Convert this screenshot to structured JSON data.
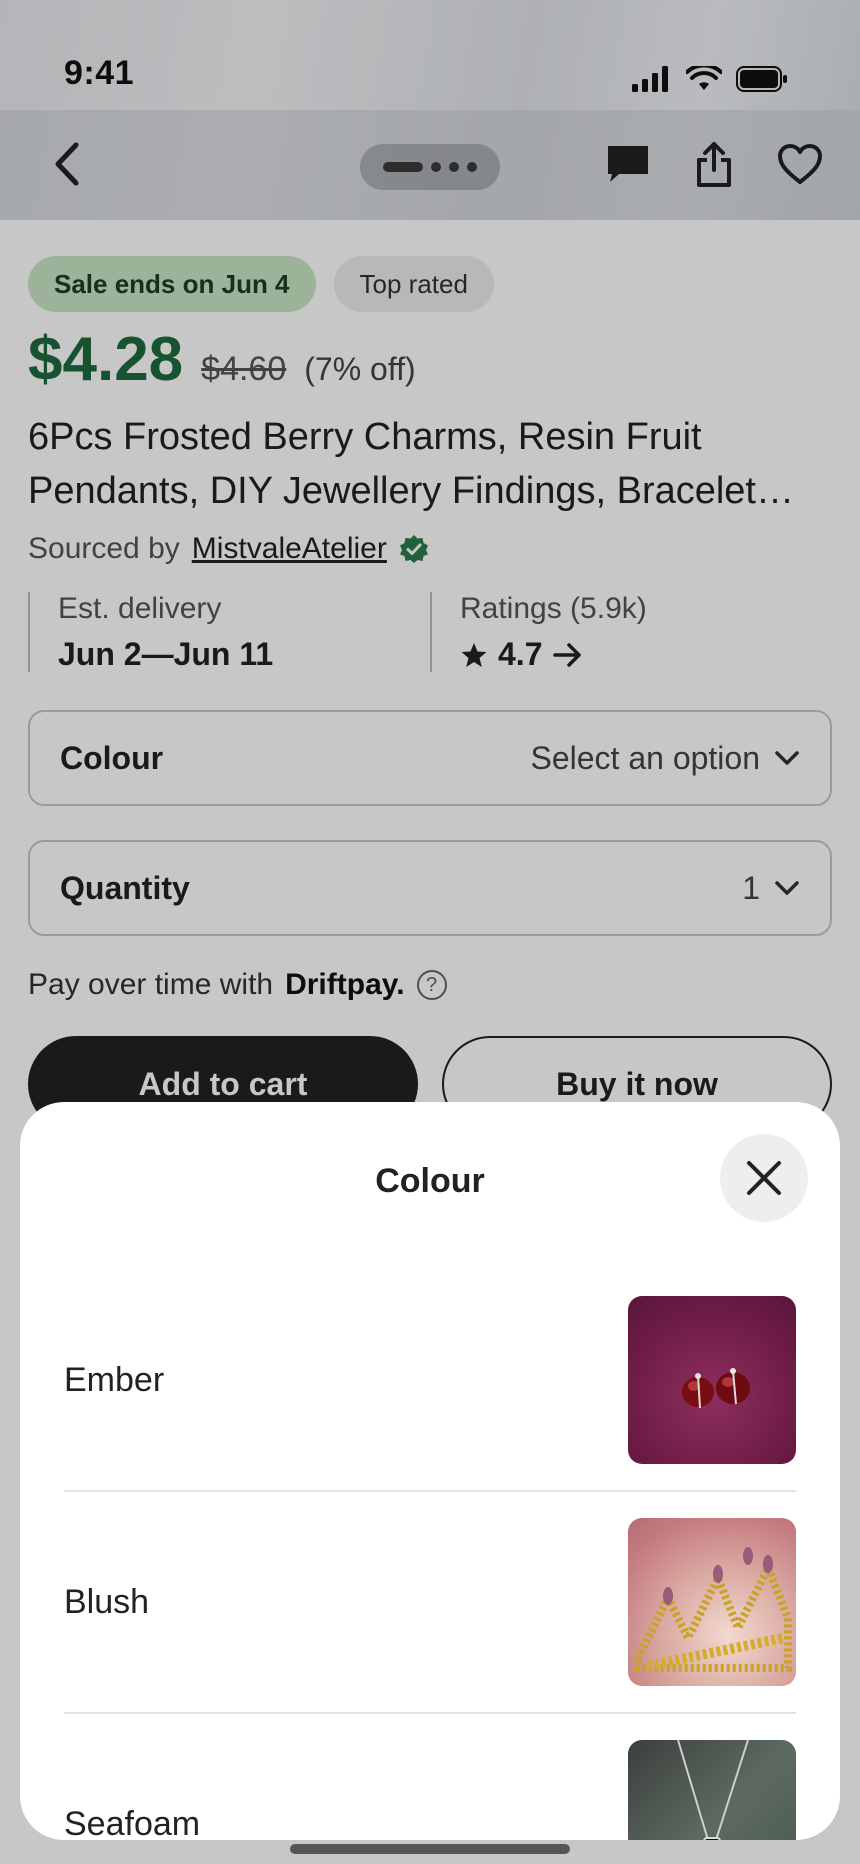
{
  "status_bar": {
    "time": "9:41"
  },
  "product": {
    "badges": {
      "sale": "Sale ends on Jun 4",
      "top_rated": "Top rated"
    },
    "price": "$4.28",
    "old_price": "$4.60",
    "discount": "(7% off)",
    "title": "6Pcs Frosted Berry Charms, Resin Fruit Pendants, DIY Jewellery Findings, Bracelet Charms",
    "sourced_prefix": "Sourced by",
    "shop_name": "MistvaleAtelier",
    "delivery": {
      "label": "Est. delivery",
      "value": "Jun 2—Jun 11"
    },
    "ratings": {
      "label": "Ratings (5.9k)",
      "value": "4.7"
    },
    "colour_select": {
      "label": "Colour",
      "value": "Select an option"
    },
    "quantity_select": {
      "label": "Quantity",
      "value": "1"
    },
    "pay": {
      "prefix": "Pay over time with",
      "brand": "Driftpay.",
      "help_glyph": "?"
    },
    "buttons": {
      "add_to_cart": "Add to cart",
      "buy_now": "Buy it now"
    }
  },
  "sheet": {
    "title": "Colour",
    "options": [
      {
        "label": "Ember",
        "thumb": "red garnet stud earrings on magenta velvet"
      },
      {
        "label": "Blush",
        "thumb": "gold beaded crown in pink box"
      },
      {
        "label": "Seafoam",
        "thumb": "silver pendant necklace on green cloth"
      }
    ]
  },
  "colors": {
    "accent_green": "#1e6b3e",
    "sale_badge_bg": "#c8e6c5",
    "verified_green": "#2f7a4d",
    "dark_button": "#222222"
  },
  "icons": [
    "back-icon",
    "chat-icon",
    "share-icon",
    "heart-icon",
    "verified-icon",
    "star-icon",
    "arrow-right-icon",
    "chevron-down-icon",
    "help-icon",
    "close-icon"
  ]
}
